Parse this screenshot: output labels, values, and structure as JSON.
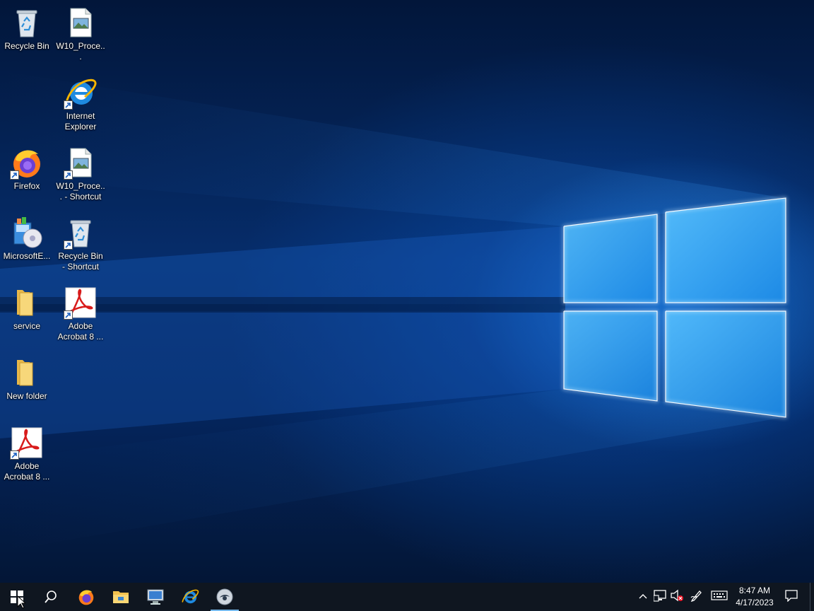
{
  "desktop": {
    "icons": [
      {
        "label": "Recycle Bin",
        "icon": "recycle-bin-icon"
      },
      {
        "label": "W10_Proce...",
        "icon": "image-file-icon"
      },
      {
        "label": "Internet Explorer",
        "icon": "internet-explorer-icon"
      },
      {
        "label": "Firefox",
        "icon": "firefox-icon"
      },
      {
        "label": "W10_Proce... - Shortcut",
        "icon": "image-file-icon"
      },
      {
        "label": "MicrosoftE...",
        "icon": "installer-icon"
      },
      {
        "label": "Recycle Bin - Shortcut",
        "icon": "recycle-bin-icon"
      },
      {
        "label": "service",
        "icon": "folder-icon"
      },
      {
        "label": "Adobe Acrobat 8 ...",
        "icon": "acrobat-icon"
      },
      {
        "label": "New folder",
        "icon": "folder-icon"
      },
      {
        "label": "Adobe Acrobat 8 ...",
        "icon": "acrobat-icon"
      }
    ]
  },
  "taskbar": {
    "pinned": [
      {
        "icon": "windows-start-icon"
      },
      {
        "icon": "search-icon"
      },
      {
        "icon": "firefox-icon"
      },
      {
        "icon": "file-explorer-icon"
      },
      {
        "icon": "remote-desktop-icon"
      },
      {
        "icon": "internet-explorer-icon"
      },
      {
        "icon": "app-icon",
        "active": true
      }
    ],
    "tray": [
      {
        "icon": "chevron-up-icon"
      },
      {
        "icon": "network-icon"
      },
      {
        "icon": "volume-muted-icon"
      },
      {
        "icon": "pen-icon"
      },
      {
        "icon": "keyboard-icon"
      },
      {
        "icon": "notification-icon"
      }
    ],
    "clock": {
      "time": "8:47 AM",
      "date": "4/17/2023"
    }
  },
  "colors": {
    "taskbar": "#0f1620",
    "active_indicator": "#76b9ed",
    "wallpaper_glow": "#2b9bff"
  }
}
